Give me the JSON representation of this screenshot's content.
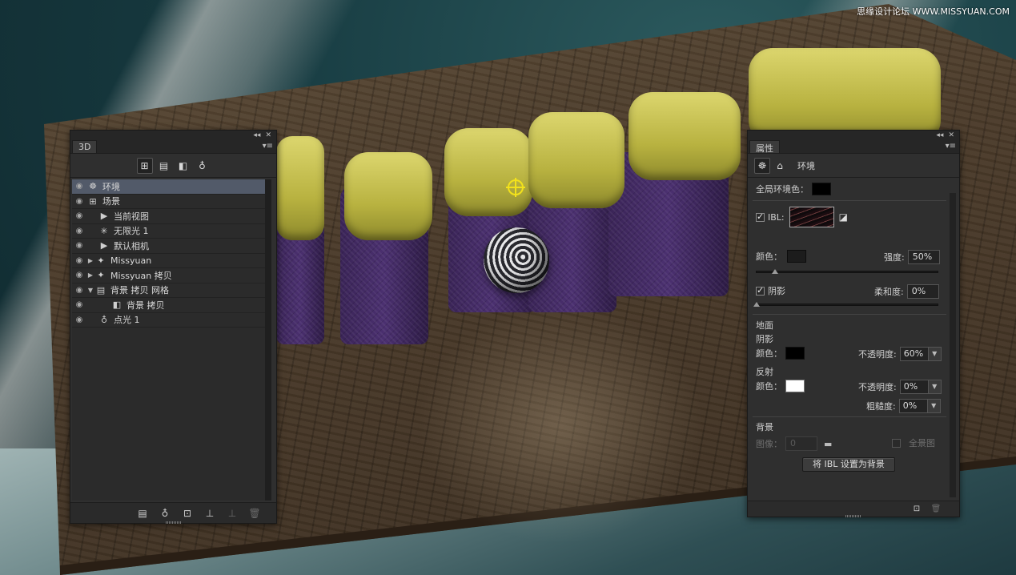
{
  "watermark": "思缘设计论坛 WWW.MISSYUAN.COM",
  "canvas": {
    "text_3d": "issyuan"
  },
  "panel_3d": {
    "tab_label": "3D",
    "toolbar_icons": [
      "filter-scene-icon",
      "filter-mesh-icon",
      "filter-material-icon",
      "filter-light-icon"
    ],
    "layers": [
      {
        "label": "环境",
        "icon": "environment-icon",
        "selected": true,
        "indent": 0
      },
      {
        "label": "场景",
        "icon": "scene-icon",
        "selected": false,
        "indent": 0
      },
      {
        "label": "当前视图",
        "icon": "camera-icon",
        "selected": false,
        "indent": 1
      },
      {
        "label": "无限光 1",
        "icon": "infinite-light-icon",
        "selected": false,
        "indent": 1
      },
      {
        "label": "默认相机",
        "icon": "camera-icon",
        "selected": false,
        "indent": 1
      },
      {
        "label": "Missyuan",
        "icon": "mesh-icon",
        "selected": false,
        "indent": 1,
        "expander": "▶"
      },
      {
        "label": "Missyuan 拷贝",
        "icon": "mesh-icon",
        "selected": false,
        "indent": 1,
        "expander": "▶"
      },
      {
        "label": "背景 拷贝 网格",
        "icon": "mesh-icon",
        "selected": false,
        "indent": 1,
        "expander": "▼"
      },
      {
        "label": "背景 拷贝",
        "icon": "material-icon",
        "selected": false,
        "indent": 2
      },
      {
        "label": "点光 1",
        "icon": "point-light-icon",
        "selected": false,
        "indent": 1
      }
    ],
    "footer_icons": [
      "new-mesh-icon",
      "new-light-icon",
      "add-constraint-icon",
      "ground-icon",
      "delete-icon"
    ]
  },
  "properties_panel": {
    "tab_label": "属性",
    "section_title": "环境",
    "global_ambient_label": "全局环境色：",
    "ibl_label": "IBL:",
    "ibl_checked": true,
    "color_label": "颜色：",
    "intensity_label": "强度:",
    "intensity_value": "50%",
    "intensity_slider": 0.1,
    "shadow_label": "阴影",
    "shadow_checked": true,
    "softness_label": "柔和度:",
    "softness_value": "0%",
    "softness_slider": 0.0,
    "ground_title": "地面",
    "ground_shadow_title": "阴影",
    "ground_shadow_color_label": "颜色：",
    "ground_shadow_opacity_label": "不透明度:",
    "ground_shadow_opacity_value": "60%",
    "reflection_title": "反射",
    "reflection_color_label": "颜色：",
    "reflection_opacity_label": "不透明度:",
    "reflection_opacity_value": "0%",
    "roughness_label": "粗糙度:",
    "roughness_value": "0%",
    "background_title": "背景",
    "image_label": "图像：",
    "image_value": "0",
    "panorama_label": "全景图",
    "set_ibl_button": "将 IBL 设置为背景",
    "colors": {
      "global_ambient": "#000000",
      "ibl_color": "#1c1c1c",
      "ground_shadow": "#000000",
      "reflection": "#ffffff"
    }
  }
}
